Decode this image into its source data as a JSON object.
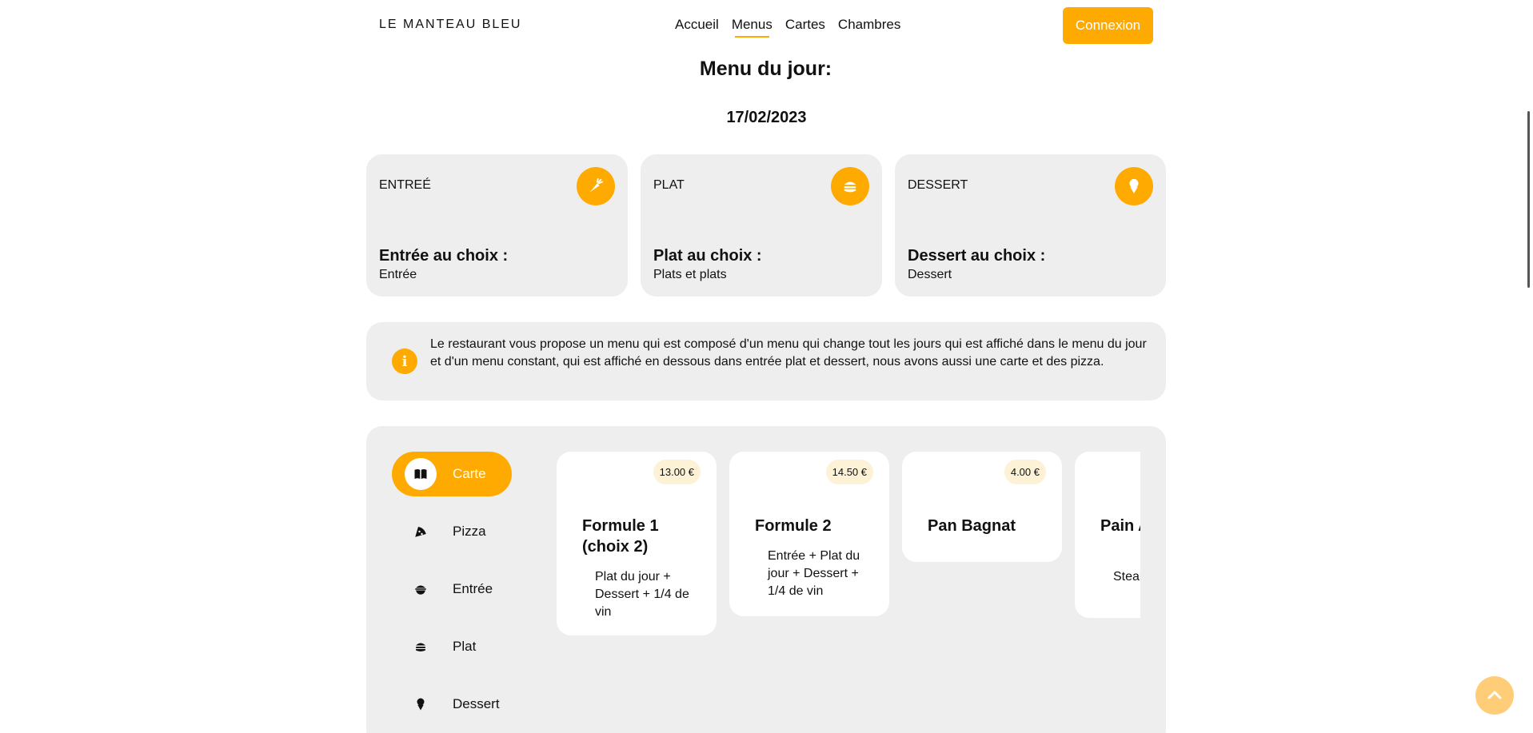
{
  "header": {
    "logo": "LE MANTEAU BLEU",
    "nav": [
      "Accueil",
      "Menus",
      "Cartes",
      "Chambres"
    ],
    "active_nav": "Menus",
    "login_label": "Connexion"
  },
  "menu_du_jour": {
    "title": "Menu du jour:",
    "date": "17/02/2023"
  },
  "courses": [
    {
      "label": "ENTREÉ",
      "icon": "carrot-icon",
      "choice_title": "Entrée au choix :",
      "choice_value": "Entrée"
    },
    {
      "label": "PLAT",
      "icon": "burger-icon",
      "choice_title": "Plat au choix :",
      "choice_value": "Plats et plats"
    },
    {
      "label": "DESSERT",
      "icon": "ice-cream-icon",
      "choice_title": "Dessert au choix :",
      "choice_value": "Dessert"
    }
  ],
  "info": {
    "icon": "info-icon",
    "text": "Le restaurant vous propose un menu qui est composé d'un menu qui change tout les jours qui est affiché dans le menu du jour et d'un menu constant, qui est affiché en dessous dans entrée plat et dessert, nous avons aussi une carte et des pizza."
  },
  "sidebar": [
    {
      "label": "Carte",
      "icon": "book-icon",
      "active": true
    },
    {
      "label": "Pizza",
      "icon": "pizza-icon",
      "active": false
    },
    {
      "label": "Entrée",
      "icon": "bowl-icon",
      "active": false
    },
    {
      "label": "Plat",
      "icon": "burger-icon",
      "active": false
    },
    {
      "label": "Dessert",
      "icon": "ice-cream-icon",
      "active": false
    }
  ],
  "products": [
    {
      "price": "13.00 €",
      "name": "Formule 1 (choix 2)",
      "description": "Plat du jour + Dessert + 1/4 de vin"
    },
    {
      "price": "14.50 €",
      "name": "Formule 2",
      "description": "Entrée + Plat du jour + Dessert + 1/4 de vin"
    },
    {
      "price": "4.00 €",
      "name": "Pan Bagnat",
      "description": ""
    },
    {
      "price": "",
      "name": "Pain Americain",
      "description": "Steak frites"
    }
  ],
  "colors": {
    "accent": "#ffaa00",
    "card_bg": "#eeeeee",
    "price_bg": "#fdf1d6"
  },
  "scroll_top_icon": "chevron-up-icon"
}
